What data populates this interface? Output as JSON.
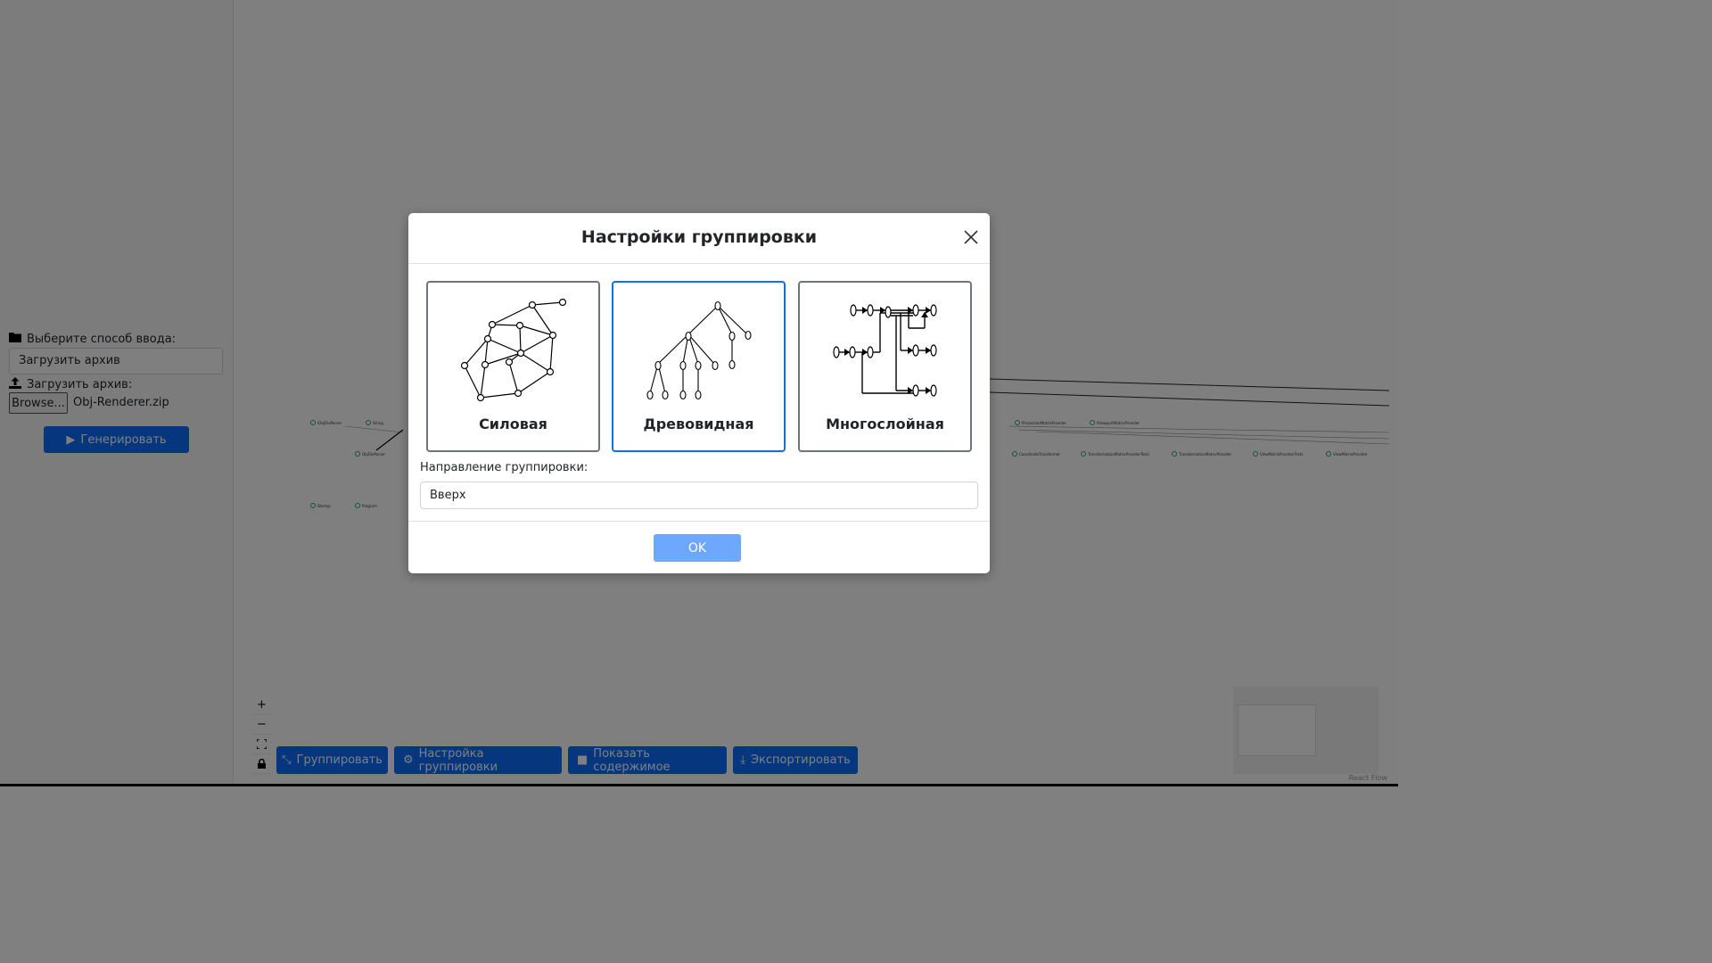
{
  "sidebar": {
    "input_mode_label": "Выберите способ ввода:",
    "input_mode_value": "Загрузить архив",
    "upload_label": "Загрузить архив:",
    "browse_label": "Browse...",
    "file_name": "Obj-Renderer.zip",
    "generate_label": "Генерировать"
  },
  "graph_nodes": [
    "IObjFileParser",
    "String",
    "ObjFileParser",
    "Startup",
    "Program",
    "IProjectionMatrixProvider",
    "IViewportMatrixProvider",
    "CoordinateTransformer",
    "TransformationMatrixProviderTests",
    "TransformationMatrixProvider",
    "ViewMatrixProviderTests",
    "ViewMatrixProvider"
  ],
  "canvas_controls": [
    "+",
    "−",
    "⛶",
    "🔒"
  ],
  "toolbar": {
    "group_label": "Группировать",
    "group_settings_label": "Настройка группировки",
    "show_content_label": "Показать содержимое",
    "export_label": "Экспортировать"
  },
  "attribution": "React Flow",
  "modal": {
    "title": "Настройки группировки",
    "layouts": [
      {
        "label": "Силовая",
        "selected": false,
        "icon": "force-graph-icon"
      },
      {
        "label": "Древовидная",
        "selected": true,
        "icon": "tree-graph-icon"
      },
      {
        "label": "Многослойная",
        "selected": false,
        "icon": "layered-graph-icon"
      }
    ],
    "direction_label": "Направление группировки:",
    "direction_value": "Вверх",
    "ok_label": "OK"
  },
  "colors": {
    "accent": "#0d6efd",
    "ok_disabled": "#6ea8fe",
    "overlay": "rgba(0,0,0,0.5)"
  }
}
